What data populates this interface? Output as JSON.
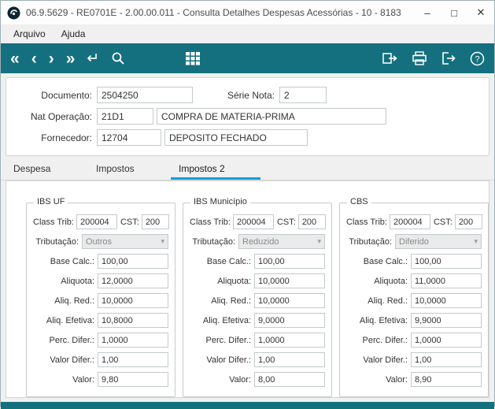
{
  "window": {
    "title": "06.9.5629 - RE0701E - 2.00.00.011 - Consulta Detalhes Despesas Acessórias - 10 - 8183"
  },
  "icons": {
    "first": "«",
    "previous": "‹",
    "next": "›",
    "last": "»",
    "confirm": "↵",
    "dropdown": "▾",
    "help_glyph": "?",
    "minimize": "–",
    "maximize": "□",
    "close": "✕"
  },
  "menu": {
    "items": [
      "Arquivo",
      "Ajuda"
    ]
  },
  "header": {
    "documento_label": "Documento:",
    "documento_value": "2504250",
    "serie_label": "Série Nota:",
    "serie_value": "2",
    "natop_label": "Nat Operação:",
    "natop_value": "21D1",
    "natop_desc": "COMPRA DE MATERIA-PRIMA",
    "fornecedor_label": "Fornecedor:",
    "fornecedor_value": "12704",
    "fornecedor_desc": "DEPOSITO FECHADO"
  },
  "tabs": [
    {
      "label": "Despesa"
    },
    {
      "label": "Impostos"
    },
    {
      "label": "Impostos 2"
    }
  ],
  "active_tab": "Impostos 2",
  "groups": [
    {
      "title": "IBS UF",
      "class_trib_label": "Class Trib:",
      "class_trib": "200004",
      "cst_label": "CST:",
      "cst": "200",
      "tributacao_label": "Tributação:",
      "tributacao": "Outros",
      "rows": [
        {
          "label": "Base Calc.:",
          "value": "100,00"
        },
        {
          "label": "Aliquota:",
          "value": "12,0000"
        },
        {
          "label": "Aliq. Red.:",
          "value": "10,0000"
        },
        {
          "label": "Aliq. Efetiva:",
          "value": "10,8000"
        },
        {
          "label": "Perc. Difer.:",
          "value": "1,0000"
        },
        {
          "label": "Valor Difer.:",
          "value": "1,00"
        },
        {
          "label": "Valor:",
          "value": "9,80"
        }
      ]
    },
    {
      "title": "IBS Município",
      "class_trib_label": "Class Trib:",
      "class_trib": "200004",
      "cst_label": "CST:",
      "cst": "200",
      "tributacao_label": "Tributação:",
      "tributacao": "Reduzido",
      "rows": [
        {
          "label": "Base Calc.:",
          "value": "100,00"
        },
        {
          "label": "Aliquota:",
          "value": "10,0000"
        },
        {
          "label": "Aliq. Red.:",
          "value": "10,0000"
        },
        {
          "label": "Aliq. Efetiva:",
          "value": "9,0000"
        },
        {
          "label": "Perc. Difer.:",
          "value": "1,0000"
        },
        {
          "label": "Valor Difer.:",
          "value": "1,00"
        },
        {
          "label": "Valor:",
          "value": "8,00"
        }
      ]
    },
    {
      "title": "CBS",
      "class_trib_label": "Class Trib:",
      "class_trib": "200004",
      "cst_label": "CST:",
      "cst": "200",
      "tributacao_label": "Tributação:",
      "tributacao": "Diferido",
      "rows": [
        {
          "label": "Base Calc.:",
          "value": "100,00"
        },
        {
          "label": "Aliquota:",
          "value": "11,0000"
        },
        {
          "label": "Aliq. Red.:",
          "value": "10,0000"
        },
        {
          "label": "Aliq. Efetiva:",
          "value": "9,9000"
        },
        {
          "label": "Perc. Difer.:",
          "value": "1,0000"
        },
        {
          "label": "Valor Difer.:",
          "value": "1,00"
        },
        {
          "label": "Valor:",
          "value": "8,90"
        }
      ]
    }
  ]
}
